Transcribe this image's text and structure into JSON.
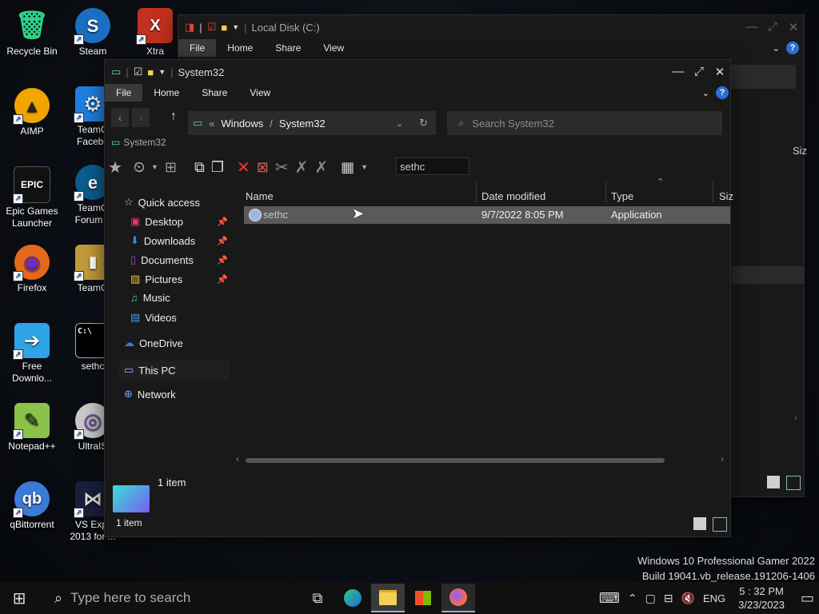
{
  "desktop": {
    "icons": [
      {
        "label": "Recycle Bin",
        "glyph": "🗑"
      },
      {
        "label": "Steam",
        "glyph": "S"
      },
      {
        "label": "Xtra",
        "glyph": "X"
      },
      {
        "label": "AIMP",
        "glyph": "▲"
      },
      {
        "label": "TeamO Facebo",
        "glyph": "⚙"
      },
      {
        "label": "Epic Games Launcher",
        "glyph": "EPIC"
      },
      {
        "label": "TeamO Forum L",
        "glyph": "e"
      },
      {
        "label": "Firefox",
        "glyph": "◉"
      },
      {
        "label": "TeamO",
        "glyph": "▮"
      },
      {
        "label": "Free Downlo...",
        "glyph": "➔"
      },
      {
        "label": "sethc",
        "glyph": "C:\\"
      },
      {
        "label": "Notepad++",
        "glyph": "✎"
      },
      {
        "label": "UltraIS",
        "glyph": "◎"
      },
      {
        "label": "qBittorrent",
        "glyph": "qb"
      },
      {
        "label": "VS Expr 2013 for ...",
        "glyph": "⋈"
      }
    ],
    "watermark_line1": "Windows 10 Professional Gamer 2022",
    "watermark_line2": "Build 19041.vb_release.191206-1406"
  },
  "back_window": {
    "title": "Local Disk (C:)",
    "tabs": [
      "File",
      "Home",
      "Share",
      "View"
    ],
    "col_size": "Siz"
  },
  "explorer": {
    "title": "System32",
    "tabs": [
      "File",
      "Home",
      "Share",
      "View"
    ],
    "breadcrumb": [
      "Windows",
      "System32"
    ],
    "breadcrumb_prefix": "«",
    "search_placeholder": "Search System32",
    "path_label": "System32",
    "toolbar_filter": "sethc",
    "nav": [
      {
        "label": "Quick access",
        "icon": "star-icon",
        "color": "#7fd3ff"
      },
      {
        "label": "Desktop",
        "icon": "desktop-folder-icon",
        "color": "#e03a6a",
        "pinned": true
      },
      {
        "label": "Downloads",
        "icon": "downloads-folder-icon",
        "color": "#2b8ee8",
        "pinned": true
      },
      {
        "label": "Documents",
        "icon": "documents-folder-icon",
        "color": "#b043f0",
        "pinned": true
      },
      {
        "label": "Pictures",
        "icon": "pictures-folder-icon",
        "color": "#f0c419",
        "pinned": true
      },
      {
        "label": "Music",
        "icon": "music-icon",
        "color": "#29d07a"
      },
      {
        "label": "Videos",
        "icon": "videos-icon",
        "color": "#3b9ef5"
      },
      {
        "label": "OneDrive",
        "icon": "onedrive-icon",
        "color": "#2f7ae5"
      },
      {
        "label": "This PC",
        "icon": "pc-icon",
        "color": "#9aa7ff"
      },
      {
        "label": "Network",
        "icon": "network-icon",
        "color": "#6ba8ff"
      }
    ],
    "columns": {
      "name": "Name",
      "date": "Date modified",
      "type": "Type",
      "size": "Siz"
    },
    "files": [
      {
        "name": "sethc",
        "date": "9/7/2022 8:05 PM",
        "type": "Application"
      }
    ],
    "status_count": "1 item",
    "preview_label": "1 item"
  },
  "taskbar": {
    "search_placeholder": "Type here to search",
    "language": "ENG",
    "time": "5 : 32 PM",
    "date": "3/23/2023"
  }
}
